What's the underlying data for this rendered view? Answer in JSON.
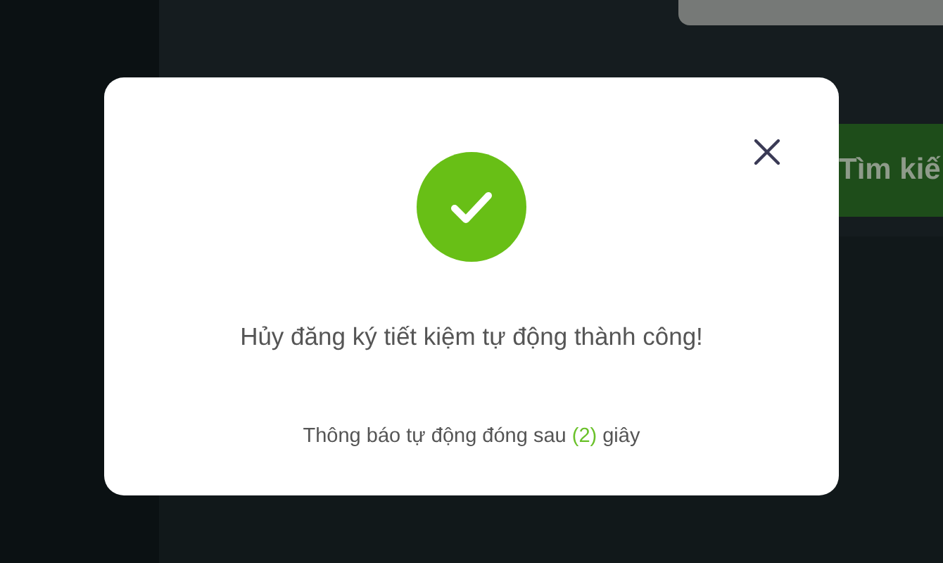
{
  "background": {
    "search_button": {
      "label": "Tìm kiế"
    }
  },
  "dialog": {
    "message": "Hủy đăng ký tiết kiệm tự động thành công!",
    "countdown": {
      "before": "Thông báo tự động đóng sau",
      "count": "(2)",
      "after": "giây"
    }
  }
}
